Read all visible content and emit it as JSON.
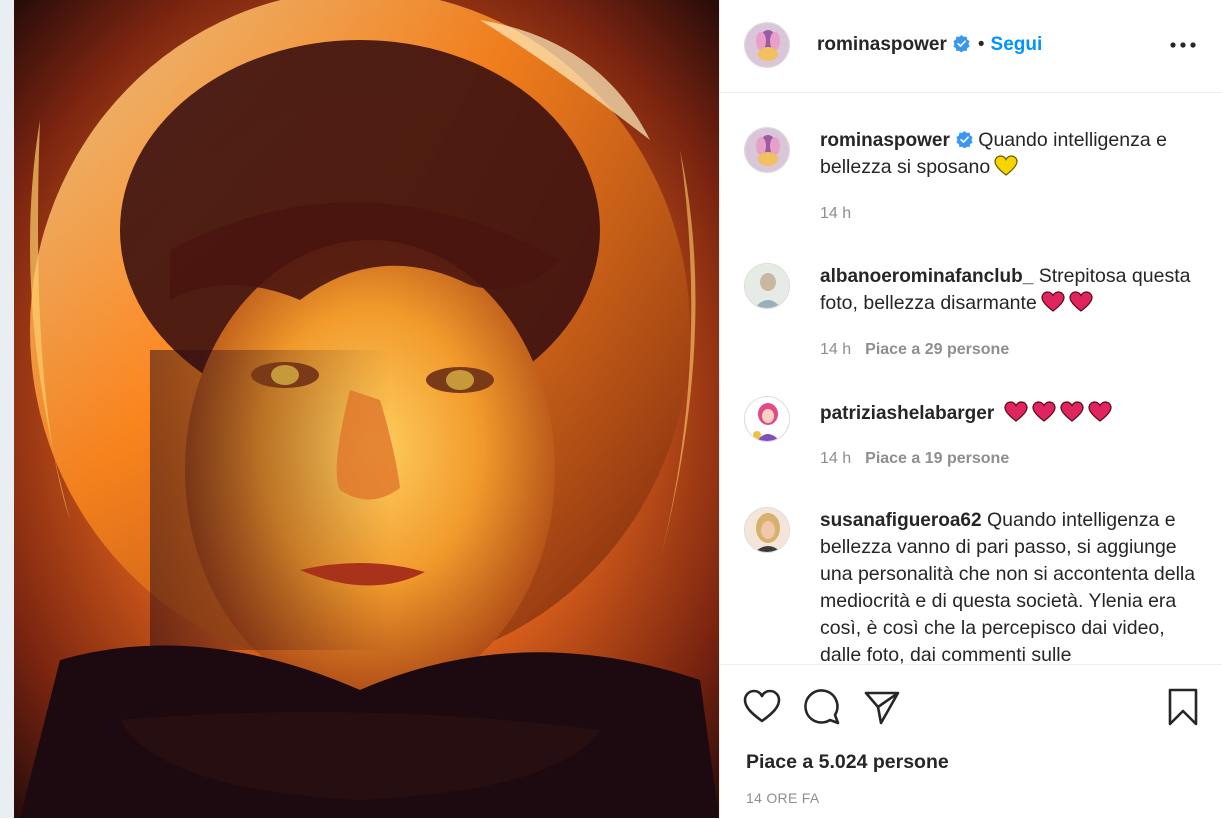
{
  "post": {
    "author": "rominaspower",
    "follow_label": "Segui",
    "dot": "•",
    "caption": "Quando intelligenza e bellezza si sposano",
    "caption_time": "14 h",
    "likes_text": "Piace a 5.024 persone",
    "timestamp": "14 ORE FA"
  },
  "comments": [
    {
      "user": "albanoerominafanclub_",
      "text": "Strepitosa questa foto, bellezza disarmante",
      "hearts": 2,
      "time": "14 h",
      "likes": "Piace a 29 persone"
    },
    {
      "user": "patriziashelabarger",
      "text": "",
      "hearts": 4,
      "time": "14 h",
      "likes": "Piace a 19 persone"
    },
    {
      "user": "susanafigueroa62",
      "text": "Quando intelligenza e bellezza vanno di pari passo, si aggiunge una personalità che non si accontenta della mediocrità e di questa società. Ylenia era così, è così che la percepisco dai video, dalle foto, dai commenti sulle"
    }
  ],
  "icons": {
    "verified": "verified-badge-icon",
    "more": "more-options-icon",
    "like": "heart-outline-icon",
    "comment": "comment-bubble-icon",
    "share": "paper-plane-icon",
    "save": "bookmark-icon",
    "emoji_yellow_heart": "yellow-heart-emoji",
    "emoji_red_heart": "red-heart-emoji"
  },
  "colors": {
    "accent": "#0095f6",
    "verified": "#3897f0",
    "muted": "#8e8e8e",
    "text": "#262626",
    "red_heart": "#e0245e",
    "yellow_heart": "#f5d400"
  }
}
